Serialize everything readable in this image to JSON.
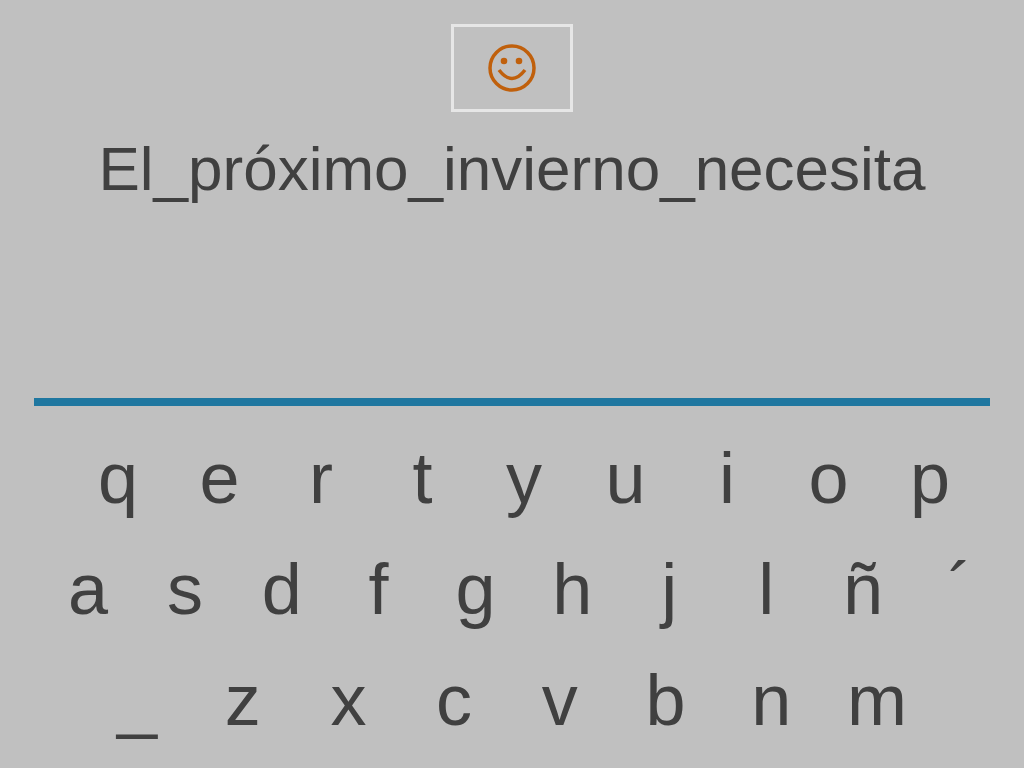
{
  "prompt": "El_próximo_invierno_necesita",
  "keyboard": {
    "rows": [
      [
        "q",
        "e",
        "r",
        "t",
        "y",
        "u",
        "i",
        "o",
        "p"
      ],
      [
        "a",
        "s",
        "d",
        "f",
        "g",
        "h",
        "j",
        "l",
        "ñ",
        "´"
      ],
      [
        "_",
        "z",
        "x",
        "c",
        "v",
        "b",
        "n",
        "m"
      ]
    ]
  }
}
